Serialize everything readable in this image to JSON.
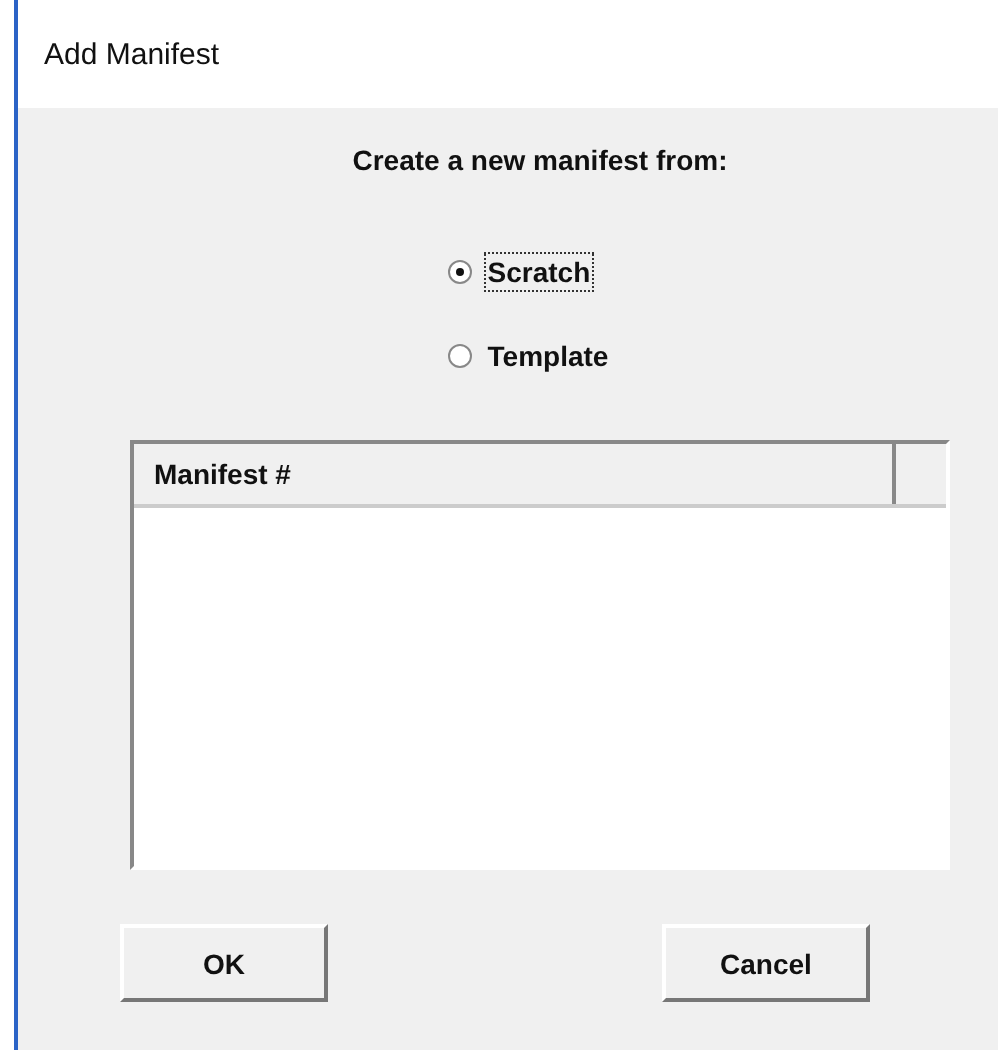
{
  "window": {
    "title": "Add Manifest"
  },
  "heading": "Create a new manifest from:",
  "options": [
    {
      "label": "Scratch",
      "selected": true,
      "focused": true
    },
    {
      "label": "Template",
      "selected": false,
      "focused": false
    }
  ],
  "list": {
    "columns": [
      "Manifest #"
    ]
  },
  "buttons": [
    "OK",
    "Cancel"
  ]
}
